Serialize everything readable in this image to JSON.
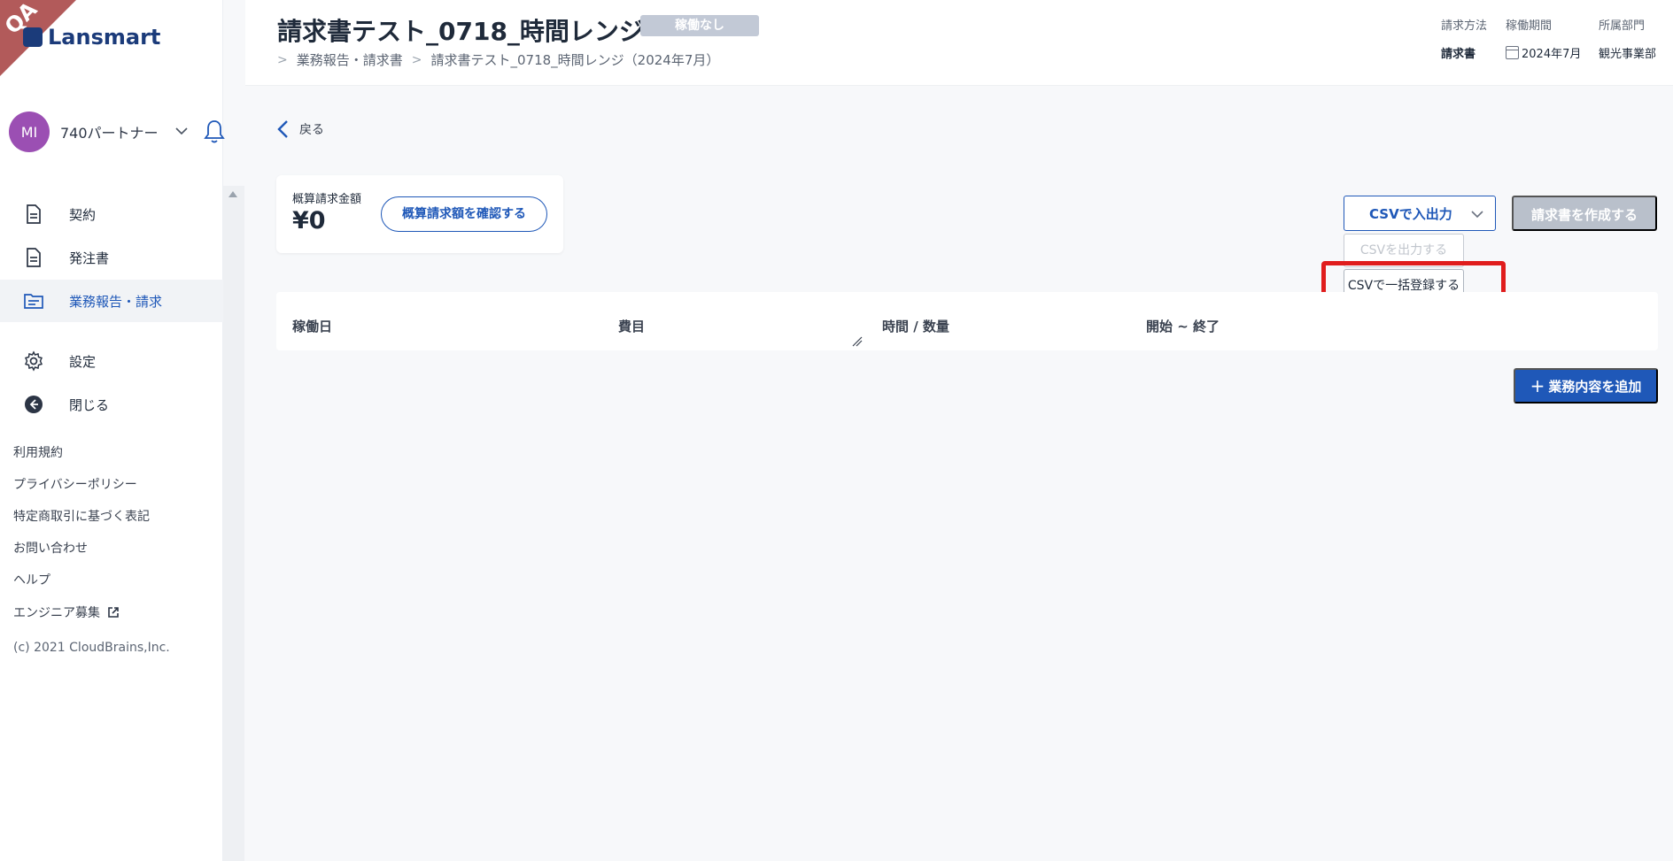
{
  "app": {
    "qa_label": "QA",
    "logo_text": "Lansmart"
  },
  "user": {
    "initials": "MI",
    "name": "740パートナー"
  },
  "sidebar": {
    "nav": [
      {
        "label": "契約"
      },
      {
        "label": "発注書"
      },
      {
        "label": "業務報告・請求"
      },
      {
        "label": "設定"
      },
      {
        "label": "閉じる"
      }
    ],
    "links": [
      {
        "label": "利用規約"
      },
      {
        "label": "プライバシーポリシー"
      },
      {
        "label": "特定商取引に基づく表記"
      },
      {
        "label": "お問い合わせ"
      },
      {
        "label": "ヘルプ"
      },
      {
        "label": "エンジニア募集"
      }
    ],
    "copyright": "(c) 2021 CloudBrains,Inc."
  },
  "header": {
    "title": "請求書テスト_0718_時間レンジ",
    "status": "稼働なし",
    "breadcrumb": [
      "業務報告・請求書",
      "請求書テスト_0718_時間レンジ（2024年7月）"
    ],
    "meta": {
      "method_label": "請求方法",
      "method_value": "請求書",
      "period_label": "稼働期間",
      "period_value": "2024年7月",
      "dept_label": "所属部門",
      "dept_value": "観光事業部"
    }
  },
  "main": {
    "back_label": "戻る",
    "estimate": {
      "label": "概算請求金額",
      "amount": "¥0",
      "button": "概算請求額を確認する"
    },
    "csv_button": "CSVで入出力",
    "csv_menu": {
      "export": "CSVを出力する",
      "bulk_import": "CSVで一括登録する"
    },
    "create_button": "請求書を作成する",
    "table_headers": [
      "稼働日",
      "費目",
      "時間 / 数量",
      "開始 ~ 終了"
    ],
    "add_button": "業務内容を追加"
  },
  "colors": {
    "primary": "#1f58b8",
    "highlight": "#e01d1d",
    "badge": "#c2c9d6",
    "avatar": "#9b4fb3"
  }
}
